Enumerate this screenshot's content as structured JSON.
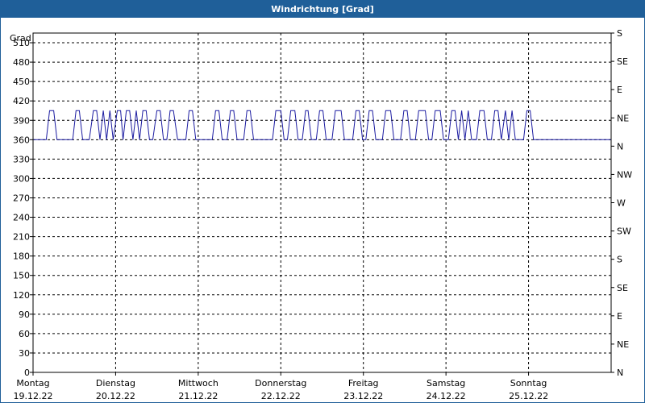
{
  "window": {
    "title": "Windrichtung [Grad]"
  },
  "chart_data": {
    "type": "line",
    "title": "Windrichtung [Grad]",
    "ylabel": "Grad",
    "ylim": [
      0,
      525
    ],
    "yticks": [
      0,
      30,
      60,
      90,
      120,
      150,
      180,
      210,
      240,
      270,
      300,
      330,
      360,
      390,
      420,
      450,
      480,
      510
    ],
    "y2ticks": [
      {
        "value": 0,
        "label": "N"
      },
      {
        "value": 45,
        "label": "NE"
      },
      {
        "value": 90,
        "label": "E"
      },
      {
        "value": 135,
        "label": "SE"
      },
      {
        "value": 180,
        "label": "S"
      },
      {
        "value": 225,
        "label": "SW"
      },
      {
        "value": 270,
        "label": "W"
      },
      {
        "value": 315,
        "label": "NW"
      },
      {
        "value": 360,
        "label": "N"
      },
      {
        "value": 405,
        "label": "NE"
      },
      {
        "value": 450,
        "label": "E"
      },
      {
        "value": 495,
        "label": "SE"
      },
      {
        "value": 540,
        "label": "S"
      }
    ],
    "xlim": [
      0,
      7
    ],
    "xticks": [
      {
        "day": 0,
        "name": "Montag",
        "date": "19.12.22"
      },
      {
        "day": 1,
        "name": "Dienstag",
        "date": "20.12.22"
      },
      {
        "day": 2,
        "name": "Mittwoch",
        "date": "21.12.22"
      },
      {
        "day": 3,
        "name": "Donnerstag",
        "date": "22.12.22"
      },
      {
        "day": 4,
        "name": "Freitag",
        "date": "23.12.22"
      },
      {
        "day": 5,
        "name": "Samstag",
        "date": "24.12.22"
      },
      {
        "day": 6,
        "name": "Sonntag",
        "date": "25.12.22"
      }
    ],
    "grid": true,
    "colors": {
      "line": "#1a1aa0",
      "header": "#1f5f99",
      "grid": "#000000"
    },
    "series": [
      {
        "x": [
          0,
          0.16,
          0.2,
          0.25,
          0.29,
          0.48,
          0.52,
          0.56,
          0.6,
          0.68,
          0.73,
          0.77,
          0.81,
          0.85,
          0.89,
          0.93,
          0.97,
          1.02,
          1.06,
          1.09,
          1.13,
          1.17,
          1.21,
          1.25,
          1.29,
          1.33,
          1.37,
          1.41,
          1.45,
          1.5,
          1.54,
          1.58,
          1.62,
          1.66,
          1.7,
          1.75,
          1.79,
          1.85,
          1.89,
          1.93,
          1.97,
          2.17,
          2.21,
          2.25,
          2.29,
          2.35,
          2.39,
          2.43,
          2.47,
          2.55,
          2.59,
          2.63,
          2.67,
          2.72,
          2.76,
          2.9,
          2.94,
          3.0,
          3.04,
          3.08,
          3.12,
          3.17,
          3.21,
          3.26,
          3.3,
          3.33,
          3.37,
          3.43,
          3.47,
          3.51,
          3.55,
          3.62,
          3.66,
          3.73,
          3.77,
          3.87,
          3.91,
          3.95,
          3.99,
          4.03,
          4.07,
          4.11,
          4.15,
          4.23,
          4.27,
          4.33,
          4.37,
          4.45,
          4.49,
          4.53,
          4.57,
          4.63,
          4.67,
          4.75,
          4.79,
          4.83,
          4.87,
          4.93,
          4.97,
          5.03,
          5.07,
          5.11,
          5.15,
          5.19,
          5.23,
          5.27,
          5.31,
          5.37,
          5.41,
          5.46,
          5.5,
          5.55,
          5.59,
          5.63,
          5.67,
          5.72,
          5.76,
          5.8,
          5.84,
          5.94,
          5.98,
          6.02,
          6.06,
          6.1,
          6.14,
          7.0
        ],
        "y": [
          360,
          360,
          405,
          405,
          360,
          360,
          405,
          405,
          360,
          360,
          405,
          405,
          360,
          405,
          360,
          405,
          360,
          405,
          405,
          360,
          405,
          405,
          360,
          405,
          360,
          405,
          405,
          360,
          360,
          405,
          405,
          360,
          360,
          405,
          405,
          360,
          360,
          360,
          405,
          405,
          360,
          360,
          405,
          405,
          360,
          360,
          405,
          405,
          360,
          360,
          405,
          405,
          360,
          360,
          360,
          360,
          405,
          405,
          360,
          360,
          405,
          405,
          360,
          360,
          405,
          405,
          360,
          360,
          405,
          405,
          360,
          360,
          405,
          405,
          360,
          360,
          405,
          405,
          360,
          360,
          405,
          405,
          360,
          360,
          405,
          405,
          360,
          360,
          405,
          405,
          360,
          360,
          405,
          405,
          360,
          360,
          405,
          405,
          360,
          360,
          405,
          405,
          360,
          405,
          360,
          405,
          360,
          360,
          405,
          405,
          360,
          360,
          405,
          405,
          360,
          405,
          360,
          405,
          360,
          360,
          405,
          405,
          360,
          360,
          360,
          360
        ]
      }
    ]
  }
}
